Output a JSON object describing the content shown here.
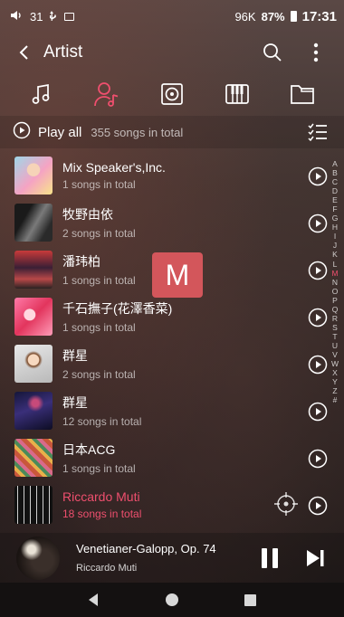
{
  "status_bar": {
    "volume_level": "31",
    "speed": "96K",
    "battery_percent": "87%",
    "time": "17:31"
  },
  "header": {
    "title": "Artist"
  },
  "tabs": [
    {
      "icon": "music-note-icon",
      "selected": false
    },
    {
      "icon": "artist-icon",
      "selected": true
    },
    {
      "icon": "album-icon",
      "selected": false
    },
    {
      "icon": "piano-icon",
      "selected": false
    },
    {
      "icon": "folder-icon",
      "selected": false
    }
  ],
  "play_all": {
    "label": "Play all",
    "count_text": "355 songs in total"
  },
  "artists": [
    {
      "name": "Mix Speaker's,Inc.",
      "count": "1 songs in total"
    },
    {
      "name": "牧野由依",
      "count": "2 songs in total"
    },
    {
      "name": "潘玮柏",
      "count": "1 songs in total"
    },
    {
      "name": "千石撫子(花澤香菜)",
      "count": "1 songs in total"
    },
    {
      "name": "群星",
      "count": "2 songs in total"
    },
    {
      "name": "群星",
      "count": "12 songs in total"
    },
    {
      "name": "日本ACG",
      "count": "1 songs in total"
    },
    {
      "name": "Riccardo Muti",
      "count": "18 songs in total"
    }
  ],
  "alphabet": [
    "A",
    "B",
    "C",
    "D",
    "E",
    "F",
    "G",
    "H",
    "I",
    "J",
    "K",
    "L",
    "M",
    "N",
    "O",
    "P",
    "Q",
    "R",
    "S",
    "T",
    "U",
    "V",
    "W",
    "X",
    "Y",
    "Z",
    "#"
  ],
  "alphabet_selected": "M",
  "letter_popup": "M",
  "now_playing": {
    "title": "Venetianer-Galopp, Op. 74",
    "artist": "Riccardo Muti"
  },
  "colors": {
    "accent": "#ef4f6e"
  }
}
